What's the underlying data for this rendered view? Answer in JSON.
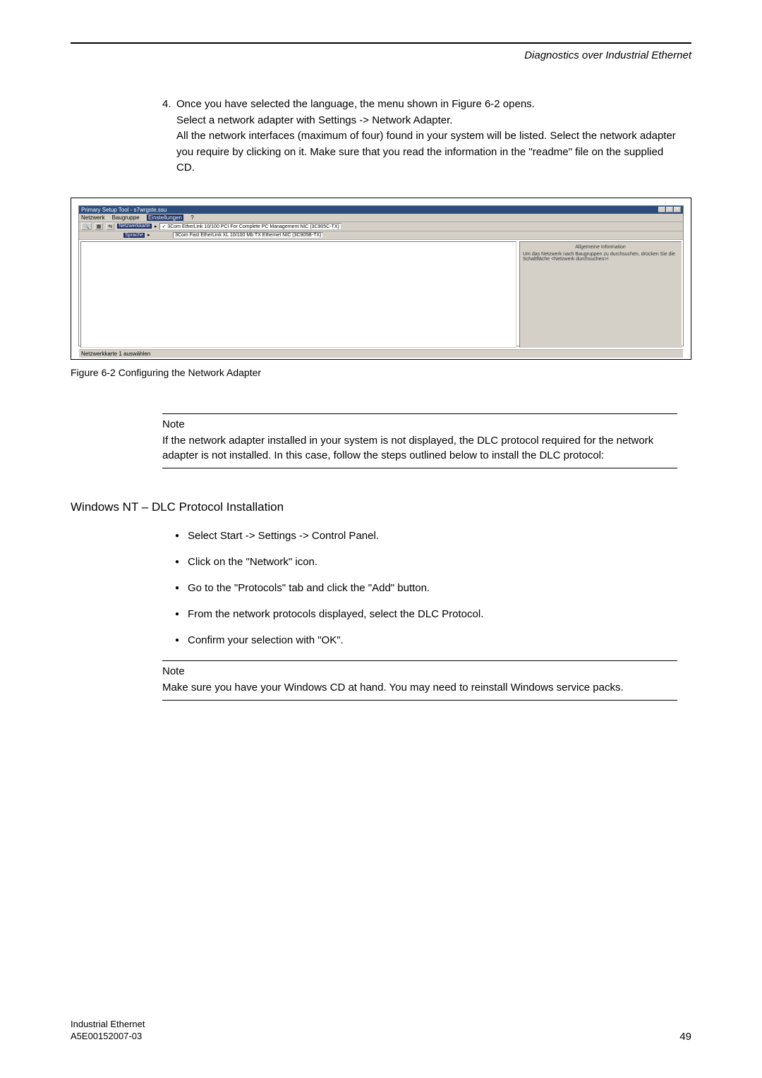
{
  "header": {
    "section_title": "Diagnostics over Industrial Ethernet"
  },
  "step4": {
    "number": "4.",
    "line1": "Once you have selected the language, the menu shown in Figure 6-2 opens.",
    "line2": "Select a network adapter with Settings -> Network Adapter.",
    "line3": "All the network interfaces (maximum of four) found in your system will be listed. Select the network adapter you require by clicking on it. Make sure that you read the information in the \"readme\" file on the supplied CD."
  },
  "figure": {
    "window_title": "Primary Setup Tool - s7wrgste.ssu",
    "menu": {
      "m1": "Netzwerk",
      "m2": "Baugruppe",
      "m3": "Einstellungen",
      "m4": "?"
    },
    "toolbar": {
      "netzwerkkarte": "Netzwerkkarte",
      "opt1": "3Com EtherLink 10/100 PCI For Complete PC Management NIC (3C905C-TX)",
      "opt2": "3Com Fast EtherLink XL 10/100 Mb TX Ethernet NIC (3C905B-TX)",
      "sprache": "Sprache"
    },
    "info_header": "Allgemeine Information",
    "info_text": "Um das Netzwerk nach Baugruppen zu durchsuchen, drücken Sie die Schaltfläche <Netzwerk durchsuchen>!",
    "status": "Netzwerkkarte 1 auswählen",
    "caption": "Figure 6-2 Configuring the Network Adapter"
  },
  "note1": {
    "title": "Note",
    "body": "If the network adapter installed in your system is not displayed, the DLC protocol required for the network adapter is not installed. In this case, follow the steps outlined below to install the DLC protocol:"
  },
  "subheading": "Windows NT – DLC Protocol Installation",
  "bullets": {
    "b1": "Select Start -> Settings -> Control Panel.",
    "b2": "Click on the \"Network\" icon.",
    "b3": "Go to the \"Protocols\" tab and click the \"Add\" button.",
    "b4": "From the network protocols displayed, select the DLC Protocol.",
    "b5": "Confirm your selection with \"OK\"."
  },
  "note2": {
    "title": "Note",
    "body": "Make sure you have your Windows CD at hand. You may need to reinstall Windows service packs."
  },
  "footer": {
    "doc_title": "Industrial Ethernet",
    "doc_id": "A5E00152007-03",
    "page": "49"
  }
}
